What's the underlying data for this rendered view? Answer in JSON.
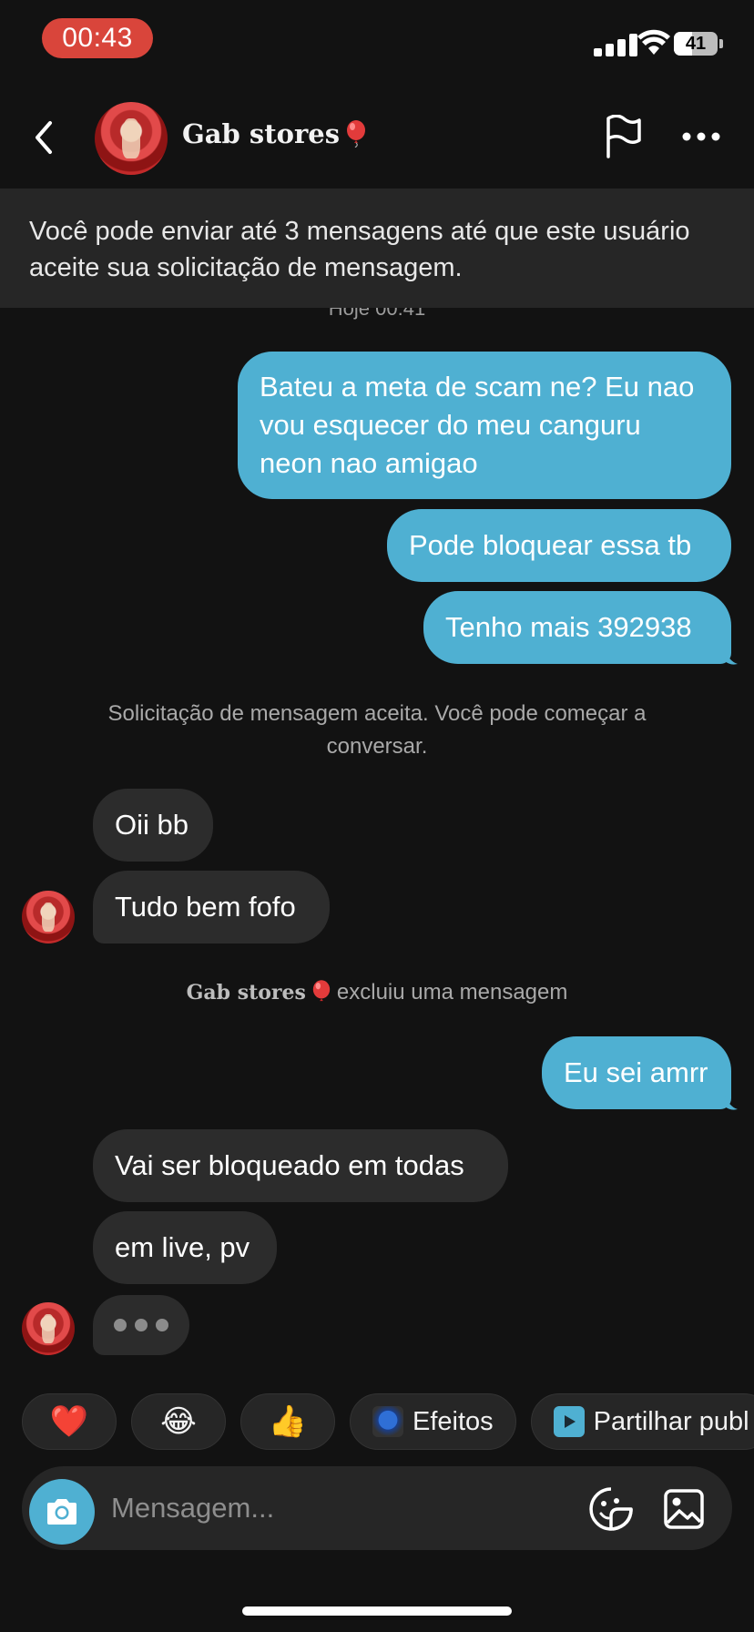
{
  "status_bar": {
    "time": "00:43",
    "battery": "41"
  },
  "header": {
    "contact_name": "Gab stores",
    "name_emoji": "balloon-icon",
    "back_icon": "chevron-left-icon",
    "flag_icon": "flag-icon",
    "more_icon": "more-horizontal-icon"
  },
  "notice": "Você pode enviar até 3 mensagens até que este usuário aceite sua solicitação de mensagem.",
  "date_stamp": "Hoje 00:41",
  "messages_out_1": [
    "Bateu a meta de scam ne? Eu nao vou esquecer do meu canguru neon nao amigao",
    "Pode bloquear essa tb",
    "Tenho mais 392938"
  ],
  "system_accepted": "Solicitação de mensagem aceita. Você pode começar a conversar.",
  "messages_in_1": [
    "Oii bb",
    "Tudo bem fofo"
  ],
  "deleted_notice": {
    "name": "Gab stores",
    "text": "excluiu uma mensagem"
  },
  "messages_out_2": [
    "Eu sei amrr"
  ],
  "messages_in_2": [
    "Vai ser bloqueado em todas",
    "em live, pv"
  ],
  "quick_actions": [
    {
      "icon": "❤️"
    },
    {
      "icon": "😂"
    },
    {
      "icon": "👍"
    },
    {
      "label": "Efeitos",
      "icon": "effects-icon"
    },
    {
      "label": "Partilhar publ",
      "icon": "share-post-icon"
    }
  ],
  "composer": {
    "placeholder": "Mensagem...",
    "camera_icon": "camera-icon",
    "sticker_icon": "sticker-icon",
    "gallery_icon": "image-icon"
  },
  "colors": {
    "background": "#121212",
    "outgoing_bubble": "#4fb0d2",
    "incoming_bubble": "#2c2c2c",
    "time_pill": "#d9453b"
  }
}
